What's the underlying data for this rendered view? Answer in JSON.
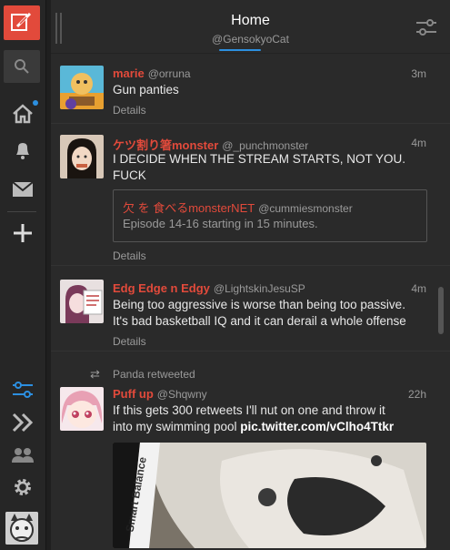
{
  "column": {
    "title": "Home",
    "subtitle": "@GensokyoCat"
  },
  "sidebar": {
    "icons": [
      "tweetdeck-logo-icon",
      "search-icon",
      "home-icon",
      "bell-icon",
      "mail-icon",
      "plus-icon",
      "filter-icon",
      "expand-icon",
      "accounts-icon",
      "gear-icon"
    ],
    "accent": "#e24a3b",
    "notify_color": "#2c8fe0"
  },
  "tweets": [
    {
      "name": "marie",
      "handle": "@orruna",
      "time": "3m",
      "text": [
        "Gun panties"
      ],
      "details": "Details"
    },
    {
      "name": "ケツ割り箸monster",
      "handle": "@_punchmonster",
      "time": "4m",
      "text": [
        "I DECIDE WHEN THE STREAM STARTS, NOT YOU.",
        "FUCK"
      ],
      "quote": {
        "name": "欠 を 食べるmonsterNET",
        "handle": "@cummiesmonster",
        "text": "Episode 14-16 starting in 15 minutes."
      },
      "details": "Details"
    },
    {
      "name": "Edg Edge n Edgy",
      "handle": "@LightskinJesuSP",
      "time": "4m",
      "text": [
        "Being too aggressive is worse than being too passive.",
        "It's bad basketball IQ and it can derail a whole offense"
      ],
      "details": "Details"
    },
    {
      "retweeted_by": "Panda retweeted",
      "name": "Puff up",
      "handle": "@Shqwny",
      "time": "22h",
      "text": [
        "If this gets 300 retweets I'll nut on one and throw it",
        "into my swimming pool "
      ],
      "link": "pic.twitter.com/vClho4Ttkr",
      "media_text": "Smart Balance"
    }
  ]
}
